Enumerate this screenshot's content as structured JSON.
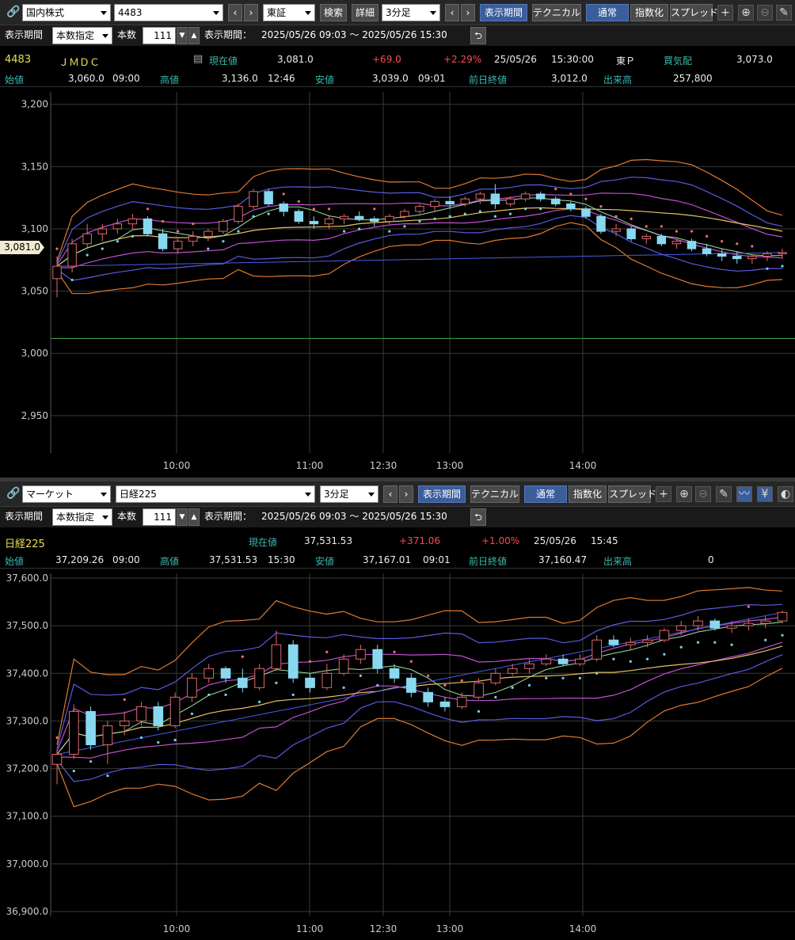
{
  "panel1": {
    "market": "国内株式",
    "code": "4483",
    "exchange": "東証",
    "search": "検索",
    "detail": "詳細",
    "interval": "3分足",
    "period_btn": "表示期間",
    "technical": "テクニカル",
    "normal": "通常",
    "index": "指数化",
    "spread": "スプレッド",
    "period_label": "表示期間",
    "period_mode": "本数指定",
    "count_label": "本数",
    "count": "111",
    "range_label": "表示期間：",
    "range": "2025/05/26 09:03 ～ 2025/05/26 15:30",
    "name_code": "4483",
    "name": "ＪＭＤＣ",
    "cur_label": "現在値",
    "cur": "3,081.0",
    "chg": "+69.0",
    "pct": "+2.29%",
    "date": "25/05/26",
    "time": "15:30:00",
    "mkt": "東Ｐ",
    "bid_label": "買気配",
    "bid": "3,073.0",
    "open_label": "始値",
    "open": "3,060.0",
    "open_t": "09:00",
    "high_label": "高値",
    "high": "3,136.0",
    "high_t": "12:46",
    "low_label": "安値",
    "low": "3,039.0",
    "low_t": "09:01",
    "prev_label": "前日終値",
    "prev": "3,012.0",
    "vol_label": "出来高",
    "vol": "257,800",
    "price_tag": "3,081.0"
  },
  "panel2": {
    "market": "マーケット",
    "code": "日経225",
    "interval": "3分足",
    "period_btn": "表示期間",
    "technical": "テクニカル",
    "normal": "通常",
    "index": "指数化",
    "spread": "スプレッド",
    "period_label": "表示期間",
    "period_mode": "本数指定",
    "count_label": "本数",
    "count": "111",
    "range_label": "表示期間：",
    "range": "2025/05/26 09:03 ～ 2025/05/26 15:30",
    "name": "日経225",
    "cur_label": "現在値",
    "cur": "37,531.53",
    "chg": "+371.06",
    "pct": "+1.00%",
    "date": "25/05/26",
    "time": "15:45",
    "open_label": "始値",
    "open": "37,209.26",
    "open_t": "09:00",
    "high_label": "高値",
    "high": "37,531.53",
    "high_t": "15:30",
    "low_label": "安値",
    "low": "37,167.01",
    "low_t": "09:01",
    "prev_label": "前日終値",
    "prev": "37,160.47",
    "vol_label": "出来高",
    "vol": "0"
  },
  "chart_data": [
    {
      "type": "candlestick",
      "title": "",
      "x_ticks": [
        "10:00",
        "11:00",
        "12:30",
        "13:00",
        "14:00"
      ],
      "y_ticks": [
        "3,200",
        "3,150",
        "3,100",
        "3,050",
        "3,000",
        "2,950"
      ],
      "ylim": [
        2920,
        3210
      ],
      "ohlc": [
        [
          3060,
          3078,
          3045,
          3070
        ],
        [
          3070,
          3092,
          3065,
          3088
        ],
        [
          3088,
          3104,
          3085,
          3096
        ],
        [
          3096,
          3104,
          3090,
          3100
        ],
        [
          3100,
          3108,
          3096,
          3104
        ],
        [
          3104,
          3112,
          3100,
          3108
        ],
        [
          3108,
          3110,
          3094,
          3096
        ],
        [
          3096,
          3100,
          3082,
          3084
        ],
        [
          3084,
          3092,
          3080,
          3090
        ],
        [
          3090,
          3098,
          3086,
          3094
        ],
        [
          3094,
          3100,
          3090,
          3098
        ],
        [
          3098,
          3108,
          3096,
          3106
        ],
        [
          3106,
          3120,
          3104,
          3118
        ],
        [
          3118,
          3132,
          3116,
          3130
        ],
        [
          3130,
          3132,
          3118,
          3120
        ],
        [
          3120,
          3122,
          3110,
          3114
        ],
        [
          3114,
          3116,
          3104,
          3106
        ],
        [
          3106,
          3110,
          3100,
          3104
        ],
        [
          3104,
          3110,
          3100,
          3108
        ],
        [
          3108,
          3112,
          3104,
          3110
        ],
        [
          3110,
          3114,
          3106,
          3108
        ],
        [
          3108,
          3110,
          3102,
          3106
        ],
        [
          3106,
          3112,
          3104,
          3110
        ],
        [
          3110,
          3116,
          3108,
          3114
        ],
        [
          3114,
          3120,
          3112,
          3118
        ],
        [
          3118,
          3124,
          3114,
          3122
        ],
        [
          3122,
          3126,
          3116,
          3120
        ],
        [
          3120,
          3126,
          3118,
          3124
        ],
        [
          3124,
          3130,
          3120,
          3128
        ],
        [
          3128,
          3136,
          3116,
          3120
        ],
        [
          3120,
          3126,
          3118,
          3124
        ],
        [
          3124,
          3130,
          3122,
          3128
        ],
        [
          3128,
          3130,
          3122,
          3124
        ],
        [
          3124,
          3126,
          3118,
          3120
        ],
        [
          3120,
          3122,
          3114,
          3116
        ],
        [
          3116,
          3118,
          3108,
          3110
        ],
        [
          3110,
          3112,
          3096,
          3098
        ],
        [
          3098,
          3104,
          3094,
          3100
        ],
        [
          3100,
          3102,
          3090,
          3092
        ],
        [
          3092,
          3096,
          3088,
          3094
        ],
        [
          3094,
          3096,
          3086,
          3088
        ],
        [
          3088,
          3092,
          3084,
          3090
        ],
        [
          3090,
          3092,
          3082,
          3084
        ],
        [
          3084,
          3088,
          3078,
          3080
        ],
        [
          3080,
          3084,
          3074,
          3078
        ],
        [
          3078,
          3082,
          3072,
          3076
        ],
        [
          3076,
          3080,
          3072,
          3078
        ],
        [
          3078,
          3082,
          3074,
          3080
        ],
        [
          3080,
          3084,
          3076,
          3081
        ]
      ],
      "ref_lines": [
        {
          "name": "prev_close",
          "value": 3012
        }
      ]
    },
    {
      "type": "candlestick",
      "title": "",
      "x_ticks": [
        "10:00",
        "11:00",
        "12:30",
        "13:00",
        "14:00"
      ],
      "y_ticks": [
        "37,600.0",
        "37,500.0",
        "37,400.0",
        "37,300.0",
        "37,200.0",
        "37,100.0",
        "37,000.0",
        "36,900.0"
      ],
      "ylim": [
        36890,
        37610
      ],
      "ohlc": [
        [
          37209,
          37240,
          37167,
          37230
        ],
        [
          37230,
          37335,
          37220,
          37320
        ],
        [
          37320,
          37330,
          37240,
          37250
        ],
        [
          37250,
          37300,
          37210,
          37290
        ],
        [
          37290,
          37320,
          37270,
          37300
        ],
        [
          37300,
          37340,
          37290,
          37330
        ],
        [
          37330,
          37340,
          37280,
          37290
        ],
        [
          37290,
          37360,
          37285,
          37350
        ],
        [
          37350,
          37400,
          37340,
          37390
        ],
        [
          37390,
          37420,
          37380,
          37410
        ],
        [
          37410,
          37415,
          37380,
          37390
        ],
        [
          37390,
          37410,
          37360,
          37370
        ],
        [
          37370,
          37420,
          37365,
          37410
        ],
        [
          37410,
          37490,
          37405,
          37460
        ],
        [
          37460,
          37470,
          37380,
          37390
        ],
        [
          37390,
          37400,
          37360,
          37370
        ],
        [
          37370,
          37420,
          37365,
          37400
        ],
        [
          37400,
          37440,
          37395,
          37430
        ],
        [
          37430,
          37460,
          37420,
          37450
        ],
        [
          37450,
          37460,
          37400,
          37410
        ],
        [
          37410,
          37420,
          37380,
          37390
        ],
        [
          37390,
          37400,
          37350,
          37360
        ],
        [
          37360,
          37370,
          37330,
          37340
        ],
        [
          37340,
          37350,
          37320,
          37330
        ],
        [
          37330,
          37360,
          37325,
          37350
        ],
        [
          37350,
          37390,
          37345,
          37380
        ],
        [
          37380,
          37410,
          37375,
          37400
        ],
        [
          37400,
          37420,
          37395,
          37410
        ],
        [
          37410,
          37430,
          37400,
          37420
        ],
        [
          37420,
          37440,
          37415,
          37430
        ],
        [
          37430,
          37440,
          37415,
          37420
        ],
        [
          37420,
          37440,
          37415,
          37430
        ],
        [
          37430,
          37480,
          37425,
          37470
        ],
        [
          37470,
          37480,
          37455,
          37460
        ],
        [
          37460,
          37475,
          37450,
          37465
        ],
        [
          37465,
          37480,
          37455,
          37470
        ],
        [
          37470,
          37495,
          37465,
          37490
        ],
        [
          37490,
          37510,
          37480,
          37500
        ],
        [
          37500,
          37520,
          37490,
          37510
        ],
        [
          37510,
          37515,
          37490,
          37495
        ],
        [
          37495,
          37510,
          37485,
          37500
        ],
        [
          37500,
          37515,
          37490,
          37505
        ],
        [
          37505,
          37520,
          37495,
          37510
        ],
        [
          37510,
          37532,
          37505,
          37528
        ]
      ]
    }
  ]
}
